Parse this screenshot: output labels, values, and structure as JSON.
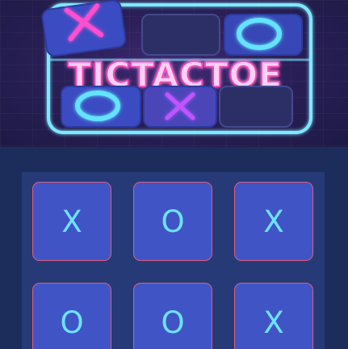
{
  "logo": {
    "title": "TICTACTOE"
  },
  "colors": {
    "neon_pink": "#ff3fbf",
    "neon_cyan": "#42d7ff",
    "neon_purple": "#b64bff",
    "cell_fill": "#4154c6",
    "cell_border": "#d9607f",
    "mark_color": "#6ee3ff",
    "board_bg": "#263a77",
    "page_bg": "#1c2d5c"
  },
  "board": {
    "cells": [
      {
        "mark": "X"
      },
      {
        "mark": "O"
      },
      {
        "mark": "X"
      },
      {
        "mark": "O"
      },
      {
        "mark": "O"
      },
      {
        "mark": "X"
      }
    ]
  }
}
